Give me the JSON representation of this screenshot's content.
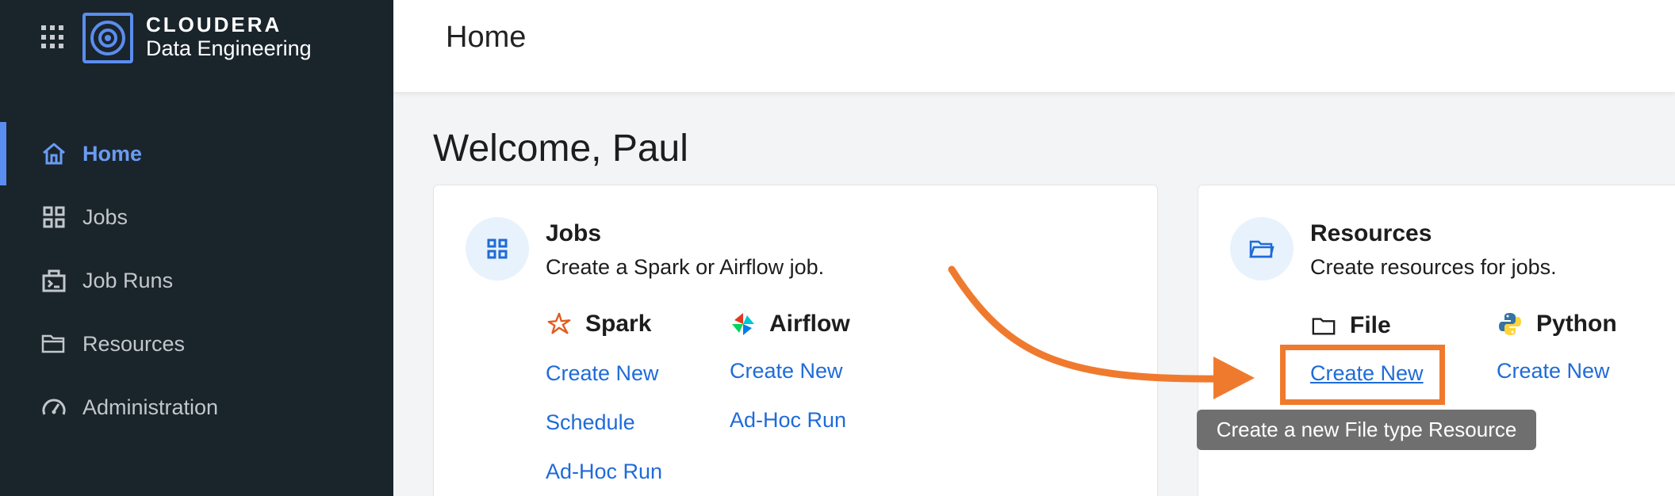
{
  "brand": {
    "name": "CLOUDERA",
    "product": "Data Engineering",
    "accent": "#5b8dee"
  },
  "sidebar": {
    "items": [
      {
        "label": "Home",
        "icon": "home-icon",
        "active": true
      },
      {
        "label": "Jobs",
        "icon": "jobs-grid-icon",
        "active": false
      },
      {
        "label": "Job Runs",
        "icon": "job-runs-icon",
        "active": false
      },
      {
        "label": "Resources",
        "icon": "folder-icon",
        "active": false
      },
      {
        "label": "Administration",
        "icon": "gauge-icon",
        "active": false
      }
    ]
  },
  "header": {
    "title": "Home"
  },
  "main": {
    "welcome": "Welcome, Paul",
    "jobs_card": {
      "title": "Jobs",
      "description": "Create a Spark or Airflow job.",
      "spark": {
        "title": "Spark",
        "links": [
          "Create New",
          "Schedule",
          "Ad-Hoc Run"
        ]
      },
      "airflow": {
        "title": "Airflow",
        "links": [
          "Create New",
          "Ad-Hoc Run"
        ]
      }
    },
    "resources_card": {
      "title": "Resources",
      "description": "Create resources for jobs.",
      "file": {
        "title": "File",
        "link": "Create New"
      },
      "python": {
        "title": "Python",
        "link": "Create New"
      }
    }
  },
  "tooltip": "Create a new File type Resource",
  "colors": {
    "sidebar_bg": "#1a242b",
    "link": "#1f6bd8",
    "annotation": "#ef7a2e"
  }
}
